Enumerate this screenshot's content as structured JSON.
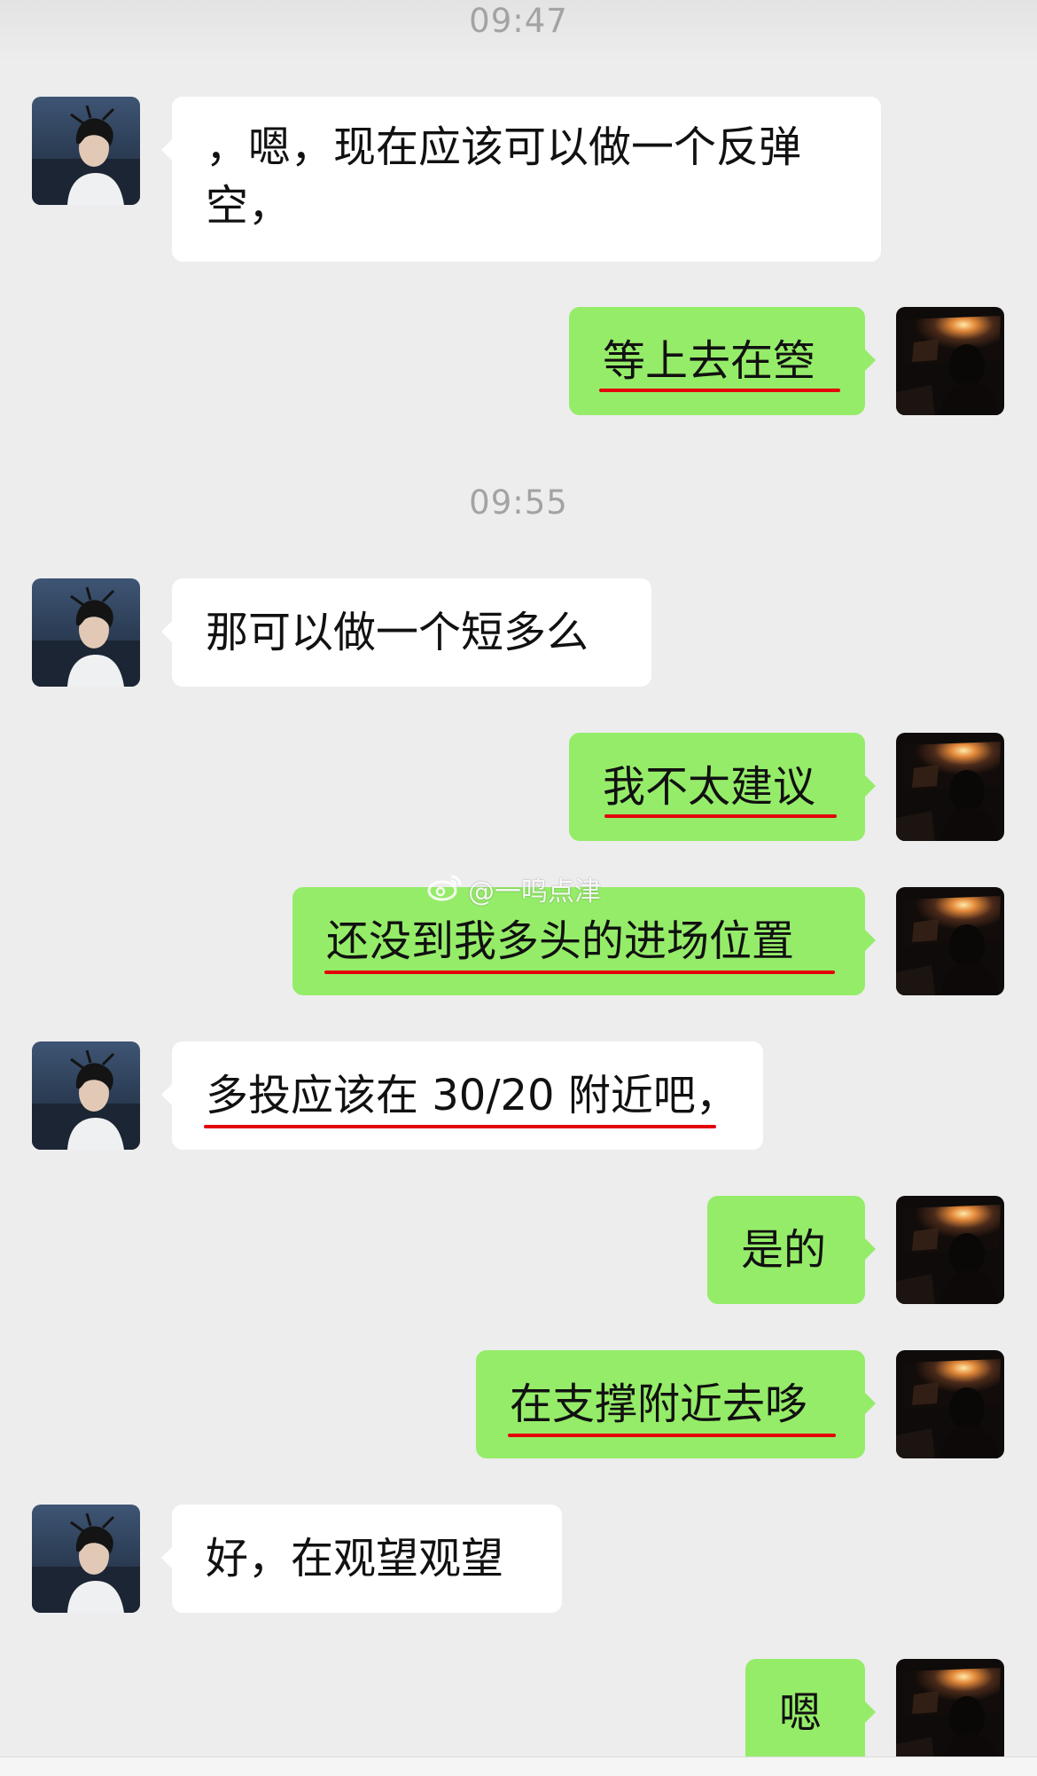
{
  "timestamps": [
    "09:47",
    "09:55"
  ],
  "contacts": {
    "other": {
      "avatar": "avatar-boy-seaside"
    },
    "me": {
      "avatar": "avatar-car-sunset"
    }
  },
  "messages": [
    {
      "side": "in",
      "text": "，嗯，现在应该可以做一个反弹空，",
      "underlined": false
    },
    {
      "side": "out",
      "text": "等上去在箜",
      "underlined": true
    },
    {
      "side": "in",
      "text": "那可以做一个短多么",
      "underlined": false
    },
    {
      "side": "out",
      "text": "我不太建议",
      "underlined": true
    },
    {
      "side": "out",
      "text": "还没到我多头的进场位置",
      "underlined": true
    },
    {
      "side": "in",
      "text": "多投应该在 30/20 附近吧，",
      "underlined": true
    },
    {
      "side": "out",
      "text": "是的",
      "underlined": false
    },
    {
      "side": "out",
      "text": "在支撑附近去哆",
      "underlined": true
    },
    {
      "side": "in",
      "text": "好，在观望观望",
      "underlined": false
    },
    {
      "side": "out",
      "text": "嗯",
      "underlined": false
    }
  ],
  "watermark": {
    "icon": "weibo-icon",
    "text": "@一鸣点津"
  },
  "colors": {
    "background": "#ededed",
    "outgoing_bubble": "#95ec69",
    "incoming_bubble": "#ffffff",
    "underline": "#e3000b",
    "timestamp": "#a3a3a3"
  }
}
